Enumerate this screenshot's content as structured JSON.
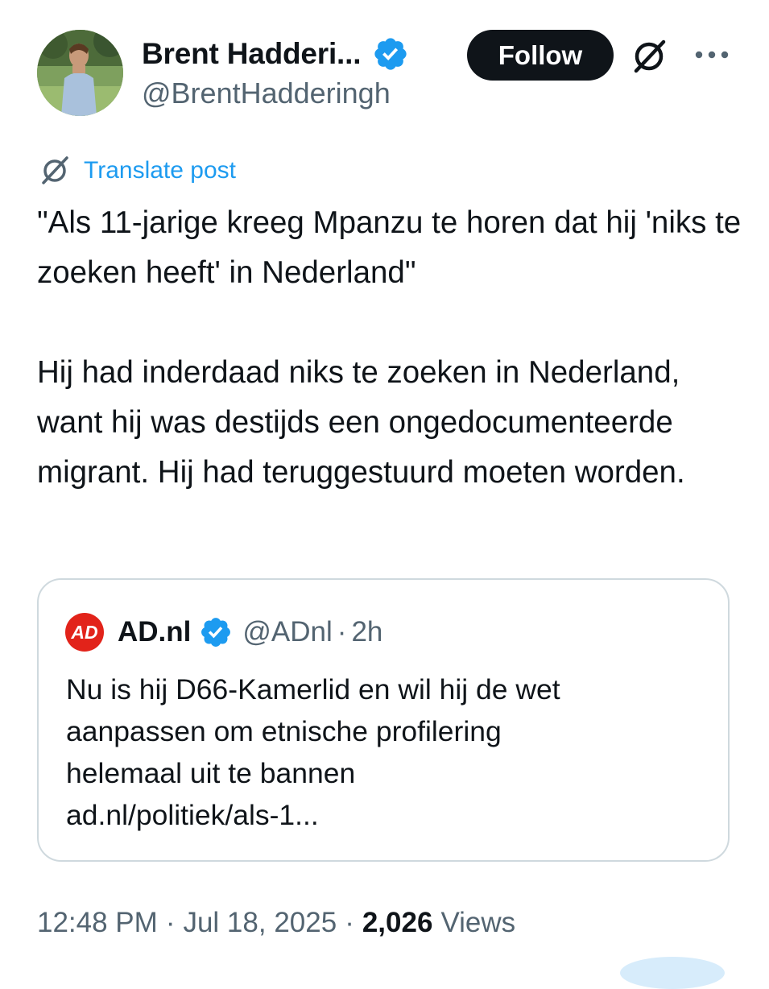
{
  "author": {
    "display_name": "Brent Hadderi...",
    "handle": "@BrentHadderingh",
    "verified": true
  },
  "actions": {
    "follow_label": "Follow"
  },
  "translate": {
    "label": "Translate post"
  },
  "post": {
    "paragraph_1": "\"Als 11-jarige kreeg Mpanzu te horen dat hij 'niks te zoeken heeft' in Nederland\"",
    "paragraph_2": "Hij had inderdaad niks te zoeken in Nederland, want hij was destijds een ongedocumenteerde migrant. Hij had teruggestuurd moeten worden."
  },
  "quote": {
    "logo_text": "AD",
    "name": "AD.nl",
    "verified": true,
    "handle": "@ADnl",
    "separator": "·",
    "time": "2h",
    "lines": [
      "Nu is hij D66-Kamerlid en wil hij de wet",
      "aanpassen om etnische profilering",
      "helemaal uit te bannen",
      "ad.nl/politiek/als-1..."
    ]
  },
  "meta": {
    "time": "12:48 PM",
    "separator": "·",
    "date": "Jul 18, 2025",
    "views_count": "2,026",
    "views_label": "Views"
  },
  "colors": {
    "accent": "#1d9bf0",
    "text": "#0f1419",
    "secondary": "#536471",
    "border": "#cfd9de",
    "ad_red": "#e2231a"
  },
  "icons": {
    "verified": "verified-badge-icon",
    "grok": "grok-icon",
    "more": "more-horizontal-icon",
    "translate": "translate-icon",
    "ad_logo": "ad-logo-icon"
  }
}
